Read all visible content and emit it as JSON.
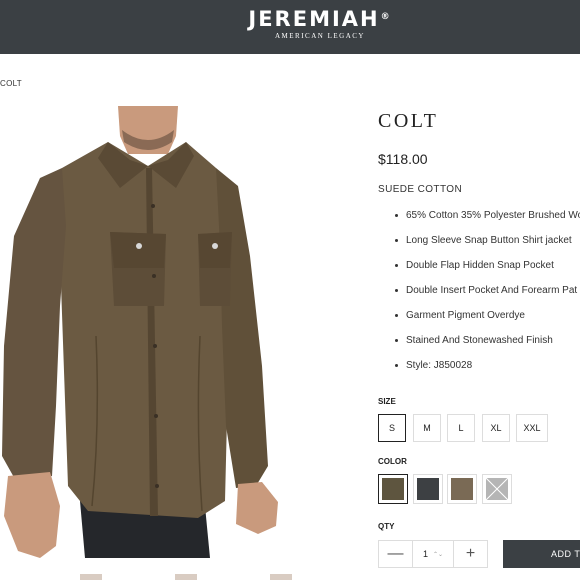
{
  "header": {
    "logo": "JEREMIAH",
    "logo_mark": "®",
    "tagline": "AMERICAN LEGACY",
    "background": "#3b4044"
  },
  "breadcrumb": "COLT",
  "product": {
    "name": "COLT",
    "price": "$118.00",
    "subtitle": "SUEDE COTTON",
    "features": [
      "65% Cotton 35% Polyester Brushed Wo",
      "Long Sleeve Snap Button Shirt jacket",
      "Double Flap Hidden Snap Pocket",
      "Double Insert Pocket And Forearm Pat",
      "Garment Pigment Overdye",
      "Stained And Stonewashed Finish",
      "Style: J850028"
    ]
  },
  "size": {
    "label": "SIZE",
    "options": [
      "S",
      "M",
      "L",
      "XL",
      "XXL"
    ],
    "selected": "S"
  },
  "color": {
    "label": "COLOR",
    "swatches": [
      "#5e553f",
      "#3d4043",
      "#7a6a55",
      "#b5b5b5"
    ],
    "selected_index": 0
  },
  "quantity": {
    "label": "QTY",
    "minus": "—",
    "value": "1",
    "spinner": "⌃⌄",
    "plus": "+"
  },
  "add_to_cart": "ADD TO",
  "image": {
    "shirt_color": "#6b5a42",
    "alt_icon": "model-wearing-shirt-photo"
  }
}
